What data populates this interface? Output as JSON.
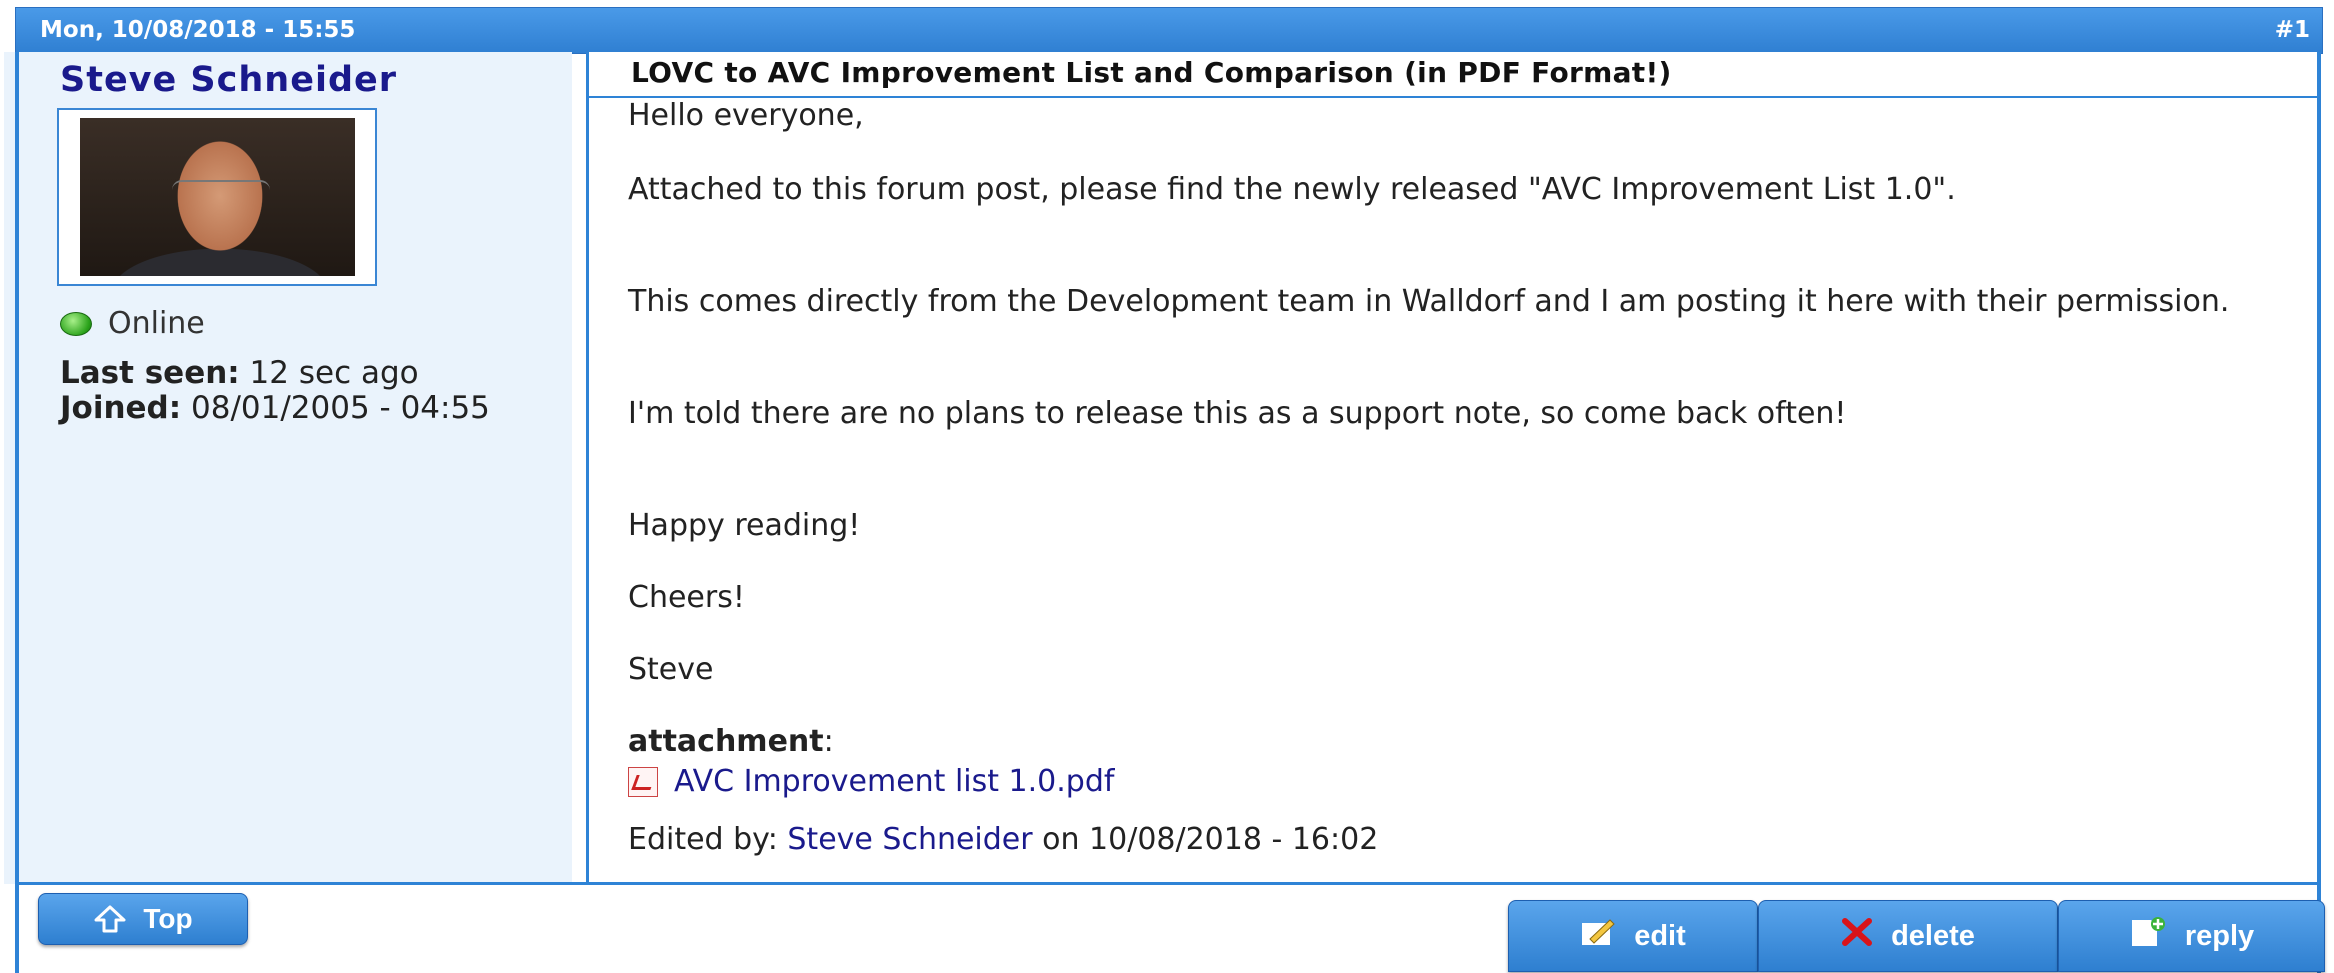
{
  "post": {
    "date": "Mon, 10/08/2018 - 15:55",
    "number": "#1",
    "subject": "LOVC to AVC Improvement List and Comparison (in PDF Format!)"
  },
  "author": {
    "name": "Steve Schneider",
    "status": "Online",
    "last_seen_label": "Last seen:",
    "last_seen_value": " 12 sec ago",
    "joined_label": "Joined:",
    "joined_value": " 08/01/2005 - 04:55"
  },
  "body": {
    "p1": "Hello everyone,",
    "p2": "Attached to this forum post, please find the newly released \"AVC Improvement List 1.0\".",
    "p3": "This comes directly from the Development team in Walldorf and I am posting it here with their permission.",
    "p4": "I'm told there are no plans to release this as a support note, so come back often!",
    "p5": "Happy reading!",
    "p6": "Cheers!",
    "p7": "Steve"
  },
  "attachment": {
    "label": "attachment",
    "colon": ":",
    "file_name": "AVC Improvement list 1.0.pdf"
  },
  "edited": {
    "prefix": "Edited by: ",
    "editor": "Steve Schneider",
    "suffix": " on 10/08/2018 - 16:02"
  },
  "buttons": {
    "top": "Top",
    "edit": "edit",
    "delete": "delete",
    "reply": "reply"
  },
  "icons": {
    "top": "arrow-up-icon",
    "edit": "pencil-icon",
    "delete": "x-icon",
    "reply": "document-plus-icon",
    "attachment": "pdf-icon",
    "status": "online-dot-icon"
  },
  "colors": {
    "header_blue": "#2f7fd2",
    "link_navy": "#1a1a8c",
    "user_pane_bg": "#eaf3fc",
    "delete_red": "#d9141a"
  }
}
